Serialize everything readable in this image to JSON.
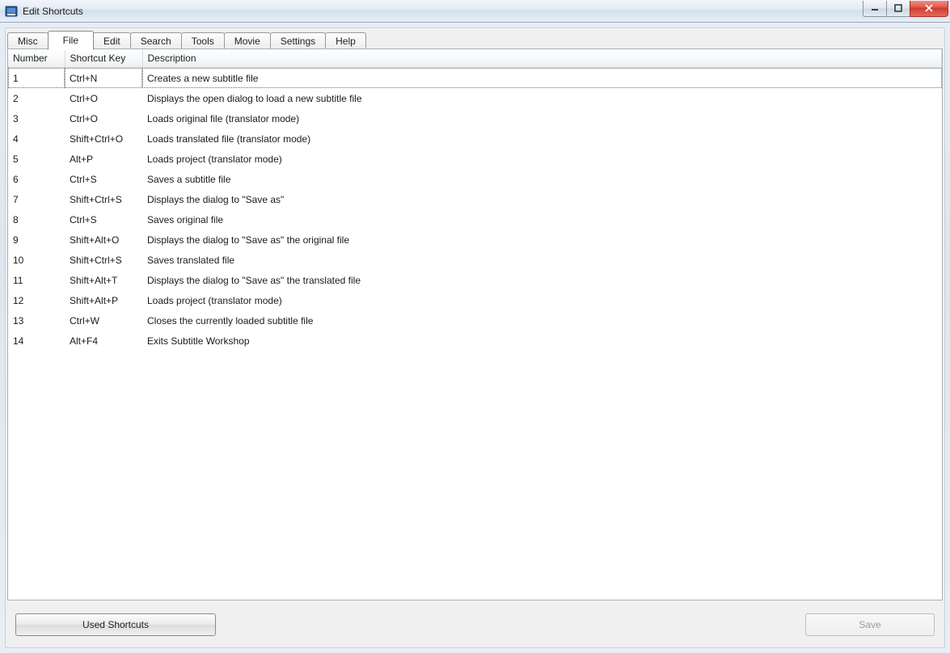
{
  "window": {
    "title": "Edit Shortcuts"
  },
  "tabs": [
    {
      "label": "Misc",
      "active": false
    },
    {
      "label": "File",
      "active": true
    },
    {
      "label": "Edit",
      "active": false
    },
    {
      "label": "Search",
      "active": false
    },
    {
      "label": "Tools",
      "active": false
    },
    {
      "label": "Movie",
      "active": false
    },
    {
      "label": "Settings",
      "active": false
    },
    {
      "label": "Help",
      "active": false
    }
  ],
  "columns": {
    "number": "Number",
    "key": "Shortcut Key",
    "desc": "Description"
  },
  "rows": [
    {
      "n": "1",
      "key": "Ctrl+N",
      "desc": "Creates a new subtitle file"
    },
    {
      "n": "2",
      "key": "Ctrl+O",
      "desc": "Displays the open dialog to load a new subtitle file"
    },
    {
      "n": "3",
      "key": "Ctrl+O",
      "desc": "Loads original file (translator mode)"
    },
    {
      "n": "4",
      "key": "Shift+Ctrl+O",
      "desc": "Loads translated file (translator mode)"
    },
    {
      "n": "5",
      "key": "Alt+P",
      "desc": "Loads project (translator mode)"
    },
    {
      "n": "6",
      "key": "Ctrl+S",
      "desc": "Saves a subtitle file"
    },
    {
      "n": "7",
      "key": "Shift+Ctrl+S",
      "desc": "Displays the dialog to \"Save as\""
    },
    {
      "n": "8",
      "key": "Ctrl+S",
      "desc": "Saves original file"
    },
    {
      "n": "9",
      "key": "Shift+Alt+O",
      "desc": "Displays the dialog to \"Save as\" the original file"
    },
    {
      "n": "10",
      "key": "Shift+Ctrl+S",
      "desc": "Saves translated file"
    },
    {
      "n": "11",
      "key": "Shift+Alt+T",
      "desc": "Displays the dialog to \"Save as\" the translated file"
    },
    {
      "n": "12",
      "key": "Shift+Alt+P",
      "desc": "Loads project (translator mode)"
    },
    {
      "n": "13",
      "key": "Ctrl+W",
      "desc": "Closes the currently loaded subtitle file"
    },
    {
      "n": "14",
      "key": "Alt+F4",
      "desc": "Exits Subtitle Workshop"
    }
  ],
  "buttons": {
    "used": "Used Shortcuts",
    "save": "Save"
  }
}
